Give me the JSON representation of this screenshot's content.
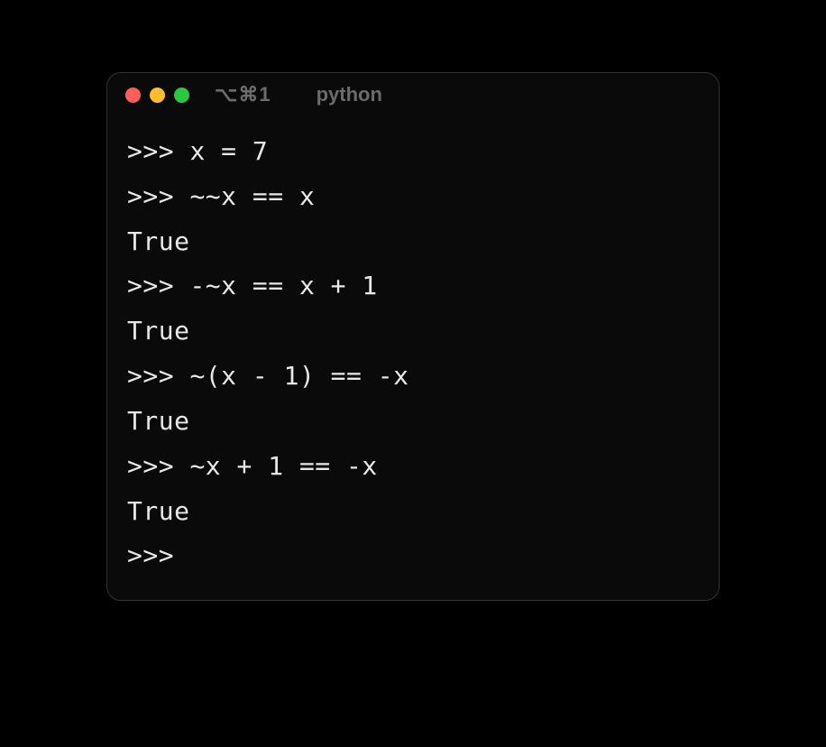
{
  "window": {
    "shortcut": "⌥⌘1",
    "title": "python",
    "traffic_lights": {
      "red": "#ff5f57",
      "yellow": "#febc2e",
      "green": "#28c840"
    }
  },
  "terminal": {
    "prompt": ">>> ",
    "lines": [
      {
        "type": "input",
        "text": "x = 7"
      },
      {
        "type": "input",
        "text": "~~x == x"
      },
      {
        "type": "output",
        "text": "True"
      },
      {
        "type": "input",
        "text": "-~x == x + 1"
      },
      {
        "type": "output",
        "text": "True"
      },
      {
        "type": "input",
        "text": "~(x - 1) == -x"
      },
      {
        "type": "output",
        "text": "True"
      },
      {
        "type": "input",
        "text": "~x + 1 == -x"
      },
      {
        "type": "output",
        "text": "True"
      },
      {
        "type": "input",
        "text": ""
      }
    ]
  }
}
